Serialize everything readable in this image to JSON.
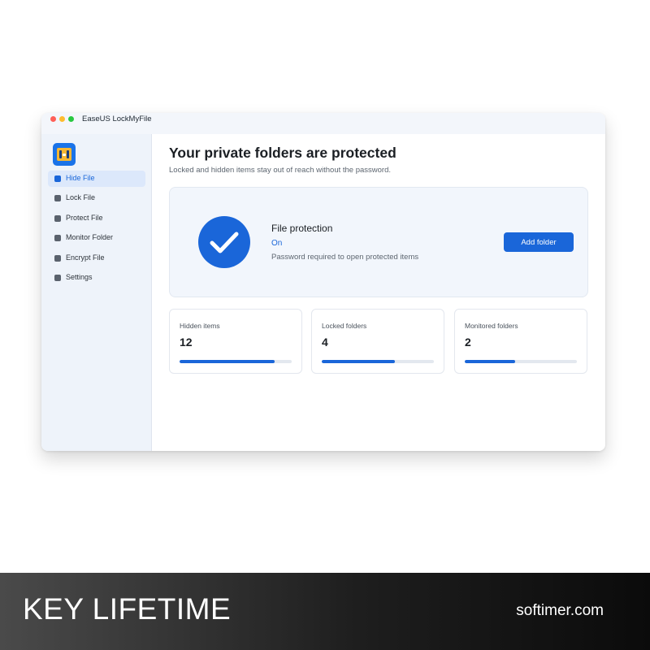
{
  "window": {
    "title": "EaseUS LockMyFile"
  },
  "sidebar": {
    "items": [
      {
        "label": "Hide File",
        "active": true
      },
      {
        "label": "Lock File",
        "active": false
      },
      {
        "label": "Protect File",
        "active": false
      },
      {
        "label": "Monitor Folder",
        "active": false
      },
      {
        "label": "Encrypt File",
        "active": false
      },
      {
        "label": "Settings",
        "active": false
      }
    ]
  },
  "main": {
    "title": "Your private folders are protected",
    "subtitle": "Locked and hidden items stay out of reach without the password.",
    "protection_card": {
      "title": "File protection",
      "status": "On",
      "description": "Password required to open protected items",
      "button_label": "Add folder",
      "icon": "check-circle-icon"
    },
    "stats": [
      {
        "label": "Hidden items",
        "value": "12",
        "progress": 0.85
      },
      {
        "label": "Locked folders",
        "value": "4",
        "progress": 0.65
      },
      {
        "label": "Monitored folders",
        "value": "2",
        "progress": 0.45
      }
    ]
  },
  "banner": {
    "left_text": "KEY LIFETIME",
    "right_text": "softimer.com"
  },
  "colors": {
    "accent": "#1a66d9",
    "sidebar_bg": "#eef3fa",
    "card_bg": "#f2f6fc"
  }
}
